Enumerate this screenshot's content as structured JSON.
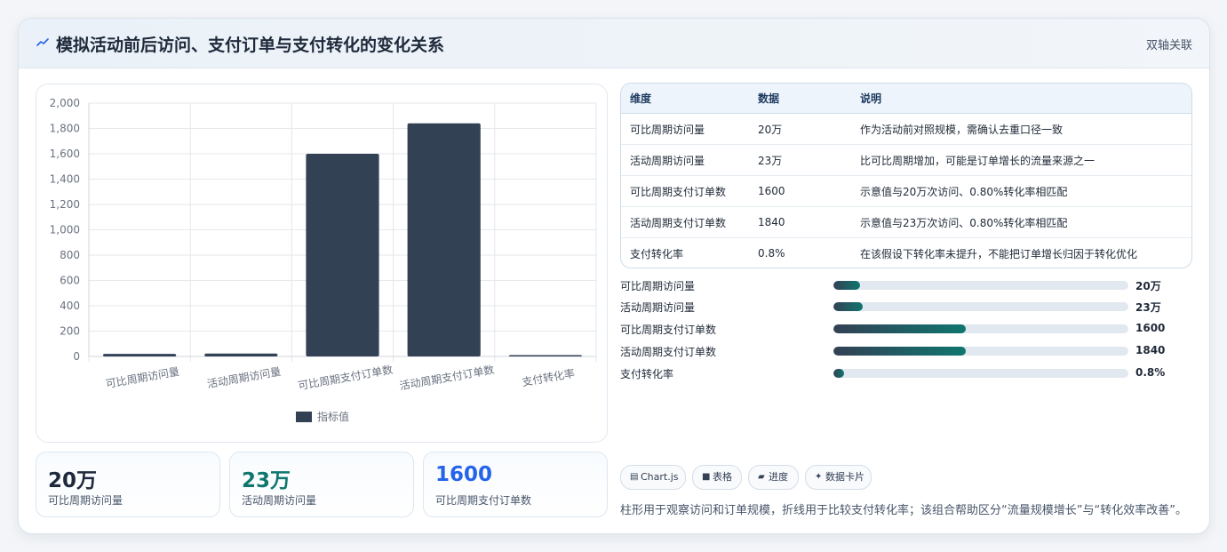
{
  "header": {
    "title": "模拟活动前后访问、支付订单与支付转化的变化关系",
    "tag": "双轴关联",
    "icon": "trend-line-icon"
  },
  "chart_data": {
    "type": "bar",
    "categories": [
      "可比周期访问量",
      "活动周期访问量",
      "可比周期支付订单数",
      "活动周期支付订单数",
      "支付转化率"
    ],
    "series": [
      {
        "name": "指标值",
        "values": [
          20,
          23,
          1600,
          1840,
          0.8
        ],
        "color": "#334155"
      }
    ],
    "y_ticks": [
      "0",
      "200",
      "400",
      "600",
      "800",
      "1,000",
      "1,200",
      "1,400",
      "1,600",
      "1,800",
      "2,000"
    ],
    "ylim": [
      0,
      2000
    ],
    "grid": true,
    "legend": "bottom"
  },
  "metrics": [
    {
      "value": "20万",
      "label": "可比周期访问量",
      "color": "#1e293b"
    },
    {
      "value": "23万",
      "label": "活动周期访问量",
      "color": "#0f766e"
    },
    {
      "value": "1600",
      "label": "可比周期支付订单数",
      "color": "#2563eb"
    }
  ],
  "table": {
    "headers": [
      "维度",
      "数据",
      "说明"
    ],
    "rows": [
      [
        "可比周期访问量",
        "20万",
        "作为活动前对照规模，需确认去重口径一致"
      ],
      [
        "活动周期访问量",
        "23万",
        "比可比周期增加，可能是订单增长的流量来源之一"
      ],
      [
        "可比周期支付订单数",
        "1600",
        "示意值与20万次访问、0.80%转化率相匹配"
      ],
      [
        "活动周期支付订单数",
        "1840",
        "示意值与23万次访问、0.80%转化率相匹配"
      ],
      [
        "支付转化率",
        "0.8%",
        "在该假设下转化率未提升，不能把订单增长归因于转化优化"
      ]
    ]
  },
  "progress": [
    {
      "label": "可比周期访问量",
      "value": "20万",
      "fraction": 0.09
    },
    {
      "label": "活动周期访问量",
      "value": "23万",
      "fraction": 0.1
    },
    {
      "label": "可比周期支付订单数",
      "value": "1600",
      "fraction": 0.45
    },
    {
      "label": "活动周期支付订单数",
      "value": "1840",
      "fraction": 0.45
    },
    {
      "label": "支付转化率",
      "value": "0.8%",
      "fraction": 0.035
    }
  ],
  "chips": [
    {
      "icon": "▤",
      "label": "Chart.js"
    },
    {
      "icon": "■",
      "label": "表格"
    },
    {
      "icon": "▰",
      "label": "进度"
    },
    {
      "icon": "✦",
      "label": "数据卡片"
    }
  ],
  "note": "柱形用于观察访问和订单规模，折线用于比较支付转化率；该组合帮助区分“流量规模增长”与“转化效率改善”。"
}
